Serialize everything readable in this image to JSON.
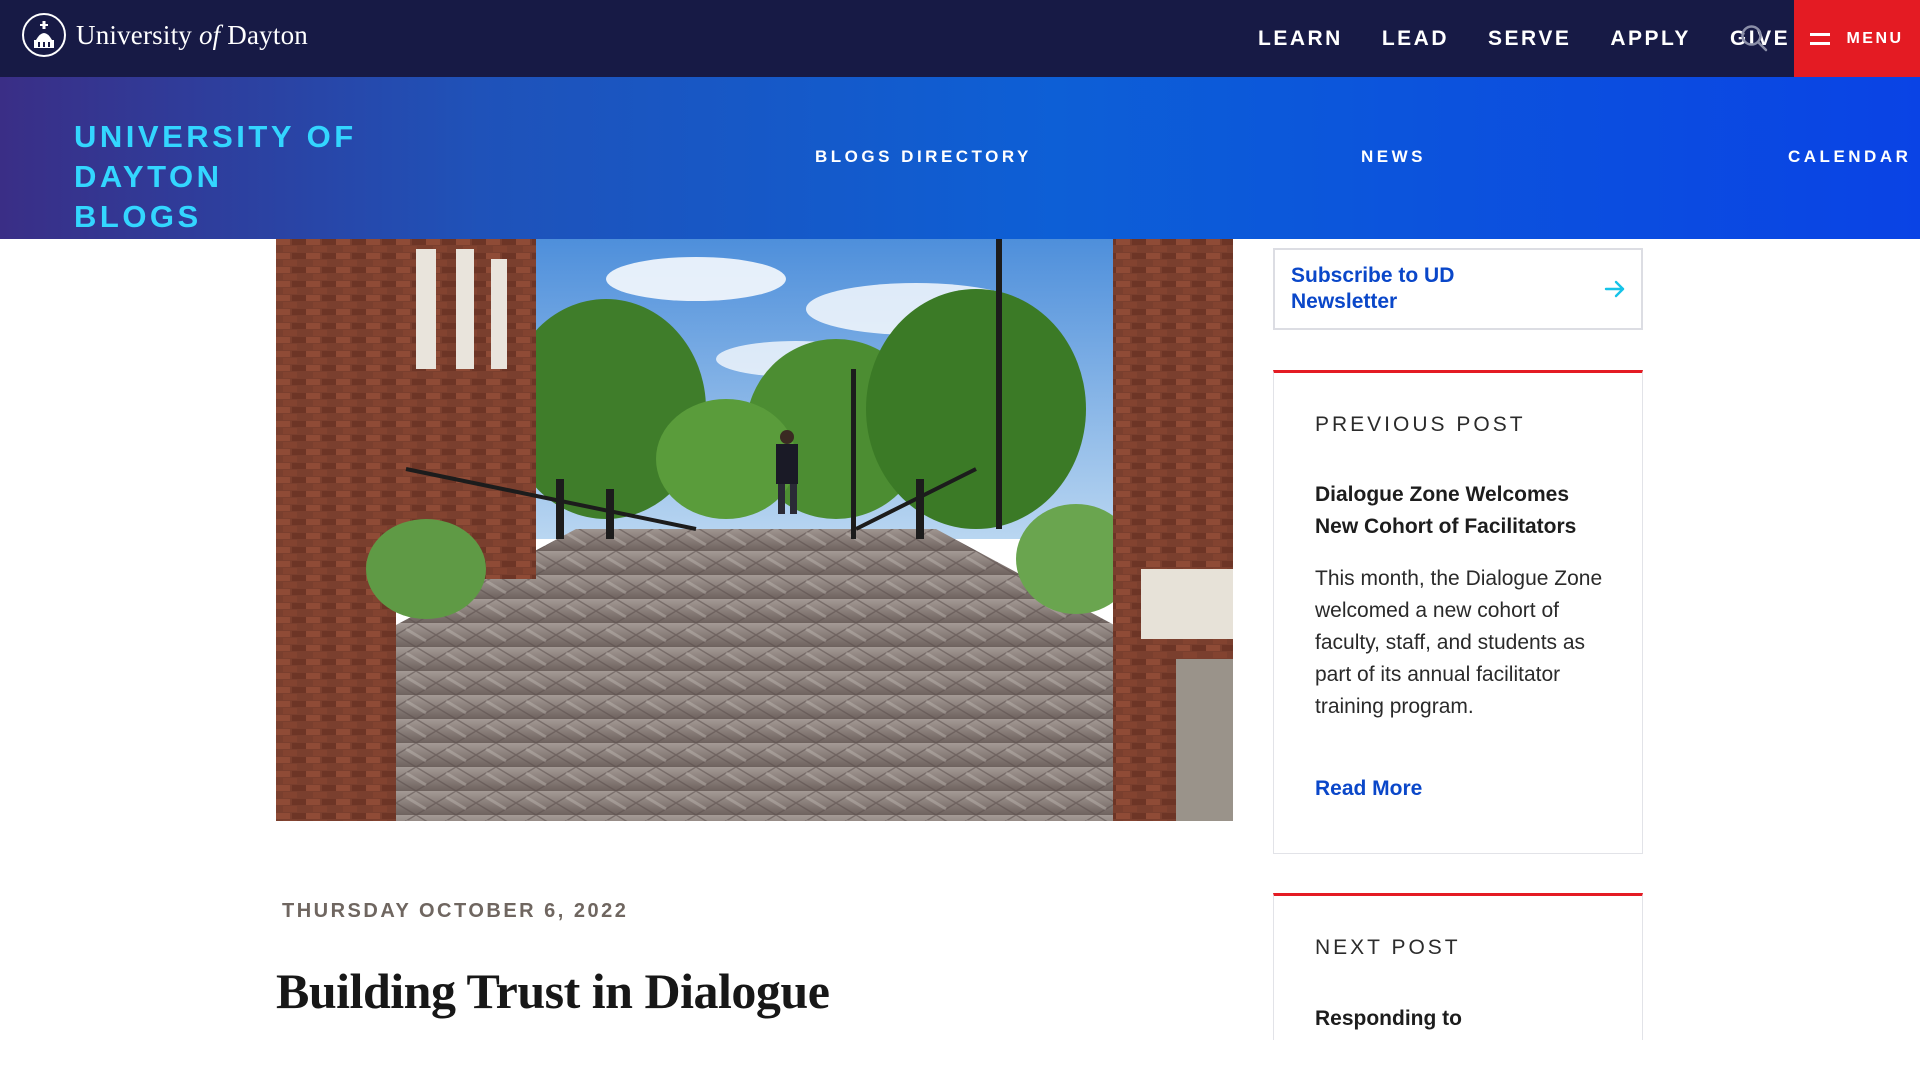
{
  "header": {
    "brand_prefix": "University ",
    "brand_italic": "of",
    "brand_suffix": " Dayton",
    "nav": [
      "LEARN",
      "LEAD",
      "SERVE",
      "APPLY",
      "GIVE"
    ],
    "search_icon": "search-icon",
    "menu_label": "MENU",
    "colors": {
      "bar": "#171a45",
      "menu": "#e41b23"
    }
  },
  "blog_header": {
    "title_line1": "UNIVERSITY OF DAYTON",
    "title_line2": "BLOGS",
    "nav": {
      "directory": "BLOGS DIRECTORY",
      "news": "NEWS",
      "calendar": "CALENDAR"
    },
    "title_color": "#33d6ff"
  },
  "post": {
    "date": "THURSDAY OCTOBER 6, 2022",
    "title": "Building Trust in Dialogue"
  },
  "sidebar": {
    "subscribe_label": "Subscribe to UD Newsletter",
    "previous": {
      "kicker": "PREVIOUS POST",
      "heading": "Dialogue Zone Welcomes New Cohort of Facilitators",
      "excerpt": "This month, the Dialogue Zone welcomed a new cohort of faculty, staff, and students as part of its annual facilitator training program.",
      "link": "Read More"
    },
    "next": {
      "kicker": "NEXT POST",
      "heading": "Responding to"
    },
    "accent": "#e41b23",
    "link_color": "#0a47c9"
  }
}
